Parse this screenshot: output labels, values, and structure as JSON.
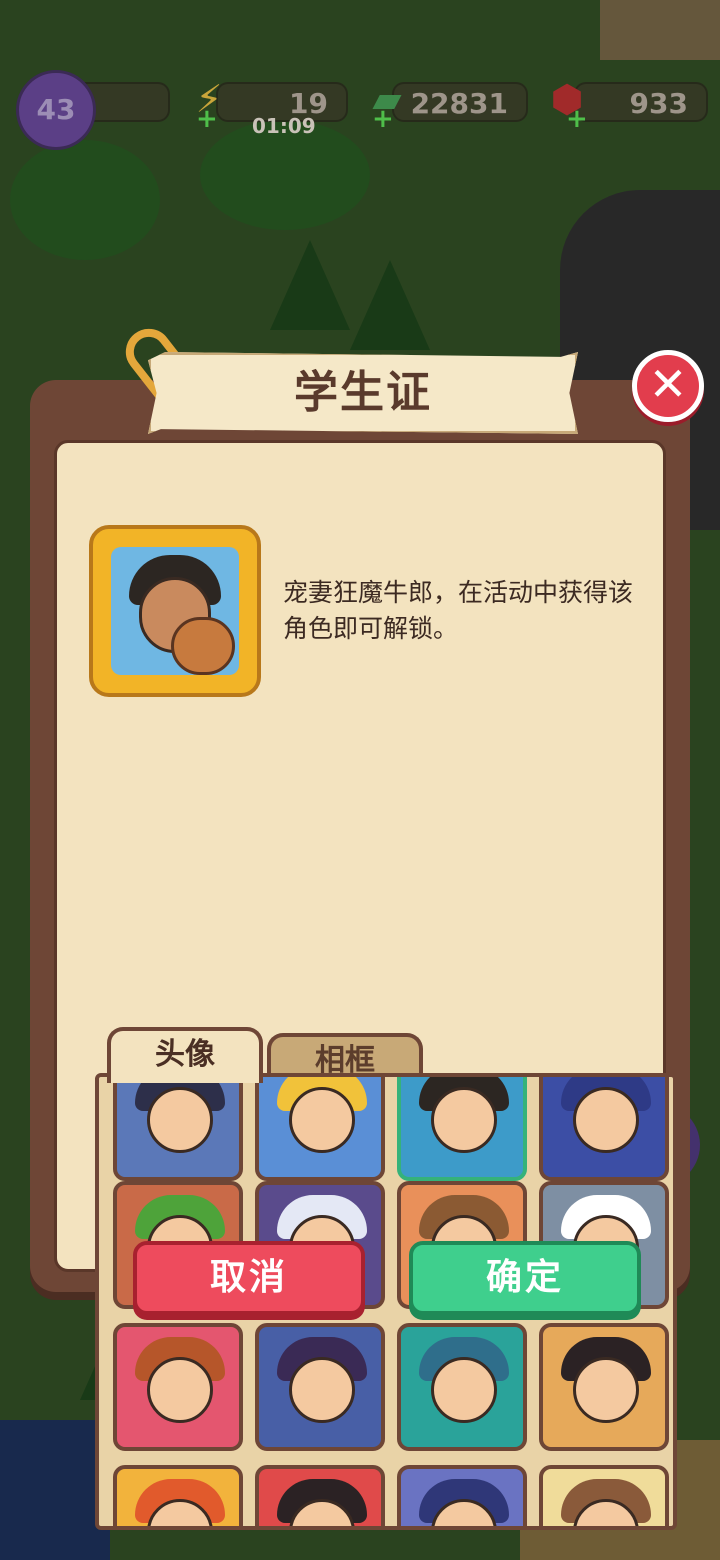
{
  "hud": {
    "level": "43",
    "energy": "19",
    "energy_timer": "01:09",
    "cash": "22831",
    "gems": "933"
  },
  "modal": {
    "title": "学生证",
    "description": "宠妻狂魔牛郎，在活动中获得该角色即可解锁。",
    "tabs": [
      "头像",
      "相框"
    ],
    "active_tab": "头像",
    "cancel_label": "取消",
    "ok_label": "确定"
  },
  "avatars": [
    {
      "name": "hooded-boy",
      "bg": "#5b78b8",
      "hair": "#2d2f4a"
    },
    {
      "name": "curly-glasses-boy",
      "bg": "#5a8fd6",
      "hair": "#f1c23a"
    },
    {
      "name": "dark-hair-man",
      "bg": "#3d9bc9",
      "hair": "#2c2622",
      "selected": true
    },
    {
      "name": "purple-hair-girl",
      "bg": "#3c4ea5",
      "hair": "#2e3a86"
    },
    {
      "name": "tree-character",
      "bg": "#c96a48",
      "hair": "#4ea33a"
    },
    {
      "name": "ghost-devil",
      "bg": "#5a4b8c",
      "hair": "#e4e8f5"
    },
    {
      "name": "hamster-hat",
      "bg": "#e9905a",
      "hair": "#8b5a33"
    },
    {
      "name": "white-poodle",
      "bg": "#7e8fa3",
      "hair": "#ffffff"
    },
    {
      "name": "redhead-woman",
      "bg": "#e4566f",
      "hair": "#b6562a"
    },
    {
      "name": "witch-hat-woman",
      "bg": "#485fa6",
      "hair": "#3a2a55"
    },
    {
      "name": "snowman",
      "bg": "#2aa39a",
      "hair": "#2f6e8b"
    },
    {
      "name": "traditional-lady",
      "bg": "#e6a95a",
      "hair": "#2b2224"
    },
    {
      "name": "fox-hat",
      "bg": "#f2b33c",
      "hair": "#e15a2c"
    },
    {
      "name": "bun-hair-girl",
      "bg": "#e04a4a",
      "hair": "#2b2224"
    },
    {
      "name": "blue-hair-boy",
      "bg": "#6a73c2",
      "hair": "#2f3778"
    },
    {
      "name": "tiara-girl",
      "bg": "#f0dc9a",
      "hair": "#8a5a3a"
    }
  ]
}
